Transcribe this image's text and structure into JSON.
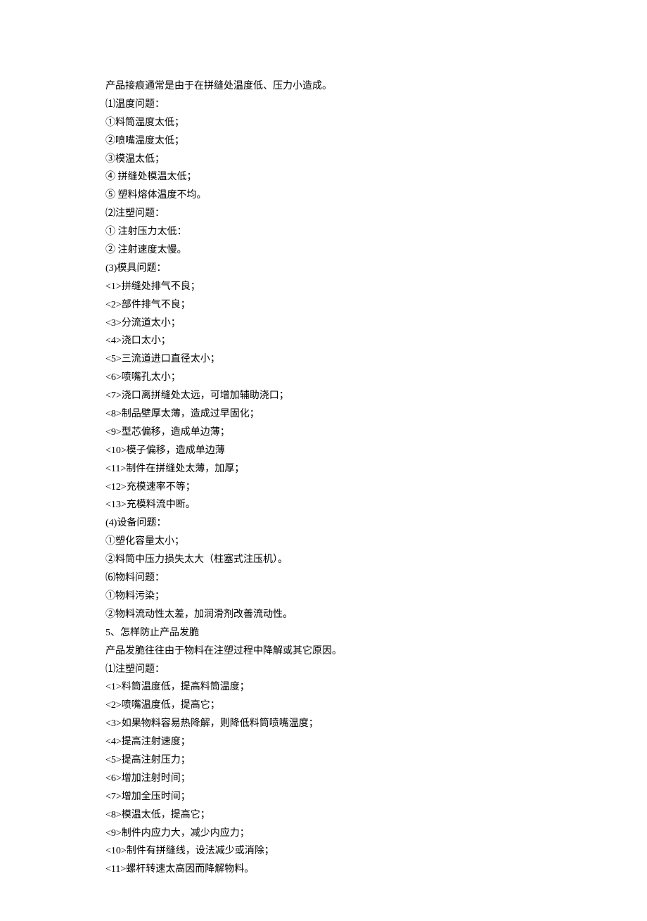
{
  "lines": [
    "产品接痕通常是由于在拼缝处温度低、压力小造成。",
    "⑴温度问题：",
    "①料筒温度太低；",
    "②喷嘴温度太低；",
    "③模温太低；",
    "④ 拼缝处模温太低；",
    "⑤ 塑料熔体温度不均。",
    "⑵注塑问题：",
    "① 注射压力太低：",
    "② 注射速度太慢。",
    "(3)模具问题：",
    "<1>拼缝处排气不良；",
    "<2>部件排气不良；",
    "<3>分流道太小；",
    "<4>浇口太小；",
    "<5>三流道进口直径太小；",
    "<6>喷嘴孔太小；",
    "<7>浇口离拼缝处太远，可增加辅助浇口；",
    "<8>制品壁厚太薄，造成过早固化；",
    "<9>型芯偏移，造成单边薄；",
    "<10>模子偏移，造成单边薄",
    "<11>制件在拼缝处太薄，加厚；",
    "<12>充模速率不等；",
    "<13>充模料流中断。",
    "(4)设备问题：",
    "①塑化容量太小；",
    "②料筒中压力损失太大（柱塞式注压机）。",
    "⑹物料问题：",
    "①物料污染；",
    "②物料流动性太差，加润滑剂改善流动性。",
    "5、怎样防止产品发脆",
    "产品发脆往往由于物料在注塑过程中降解或其它原因。",
    "⑴注塑问题：",
    "<1>料筒温度低，提高料筒温度；",
    "<2>喷嘴温度低，提高它；",
    "<3>如果物料容易热降解，则降低料筒喷嘴温度；",
    "<4>提高注射速度；",
    "<5>提高注射压力；",
    "<6>增加注射时间；",
    "<7>增加全压时间；",
    "<8>模温太低，提高它；",
    "<9>制件内应力大，减少内应力；",
    "<10>制件有拼缝线，设法减少或消除；",
    "<11>螺杆转速太高因而降解物料。"
  ]
}
